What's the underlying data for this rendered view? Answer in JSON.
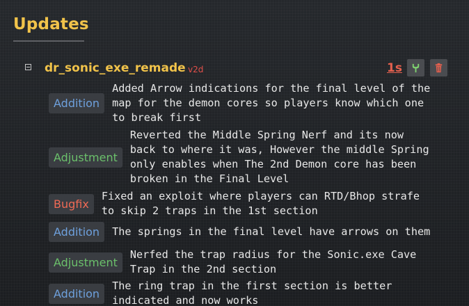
{
  "section": {
    "title": "Updates"
  },
  "mod": {
    "name": "dr_sonic_exe_remade",
    "version": "v2d",
    "time_ago": "1s",
    "edit_icon": "wrench-icon",
    "delete_icon": "trash-icon"
  },
  "colors": {
    "accent": "#f1c34a",
    "version": "#e2504a",
    "addition": "#6ea0dc",
    "adjustment": "#6bc06b",
    "bugfix": "#ef6a55"
  },
  "changes": [
    {
      "type": "Addition",
      "lines": [
        "Added Arrow indications for the final level of the",
        "map for the demon cores so players know which one",
        "to break first"
      ]
    },
    {
      "type": "Adjustment",
      "lines": [
        "Reverted the Middle Spring Nerf and its now",
        "back to where it was, However the middle Spring",
        "only enables when The 2nd Demon core has been",
        "broken in the Final Level"
      ]
    },
    {
      "type": "Bugfix",
      "lines": [
        "Fixed an exploit where players can RTD/Bhop strafe",
        "to skip 2 traps in the 1st section"
      ]
    },
    {
      "type": "Addition",
      "lines": [
        "The springs in the final level have arrows on them"
      ]
    },
    {
      "type": "Adjustment",
      "lines": [
        "Nerfed the trap radius for the Sonic.exe Cave",
        "Trap in the 2nd section"
      ]
    },
    {
      "type": "Addition",
      "lines": [
        "The ring trap in the first section is better",
        "indicated and now works"
      ]
    }
  ]
}
